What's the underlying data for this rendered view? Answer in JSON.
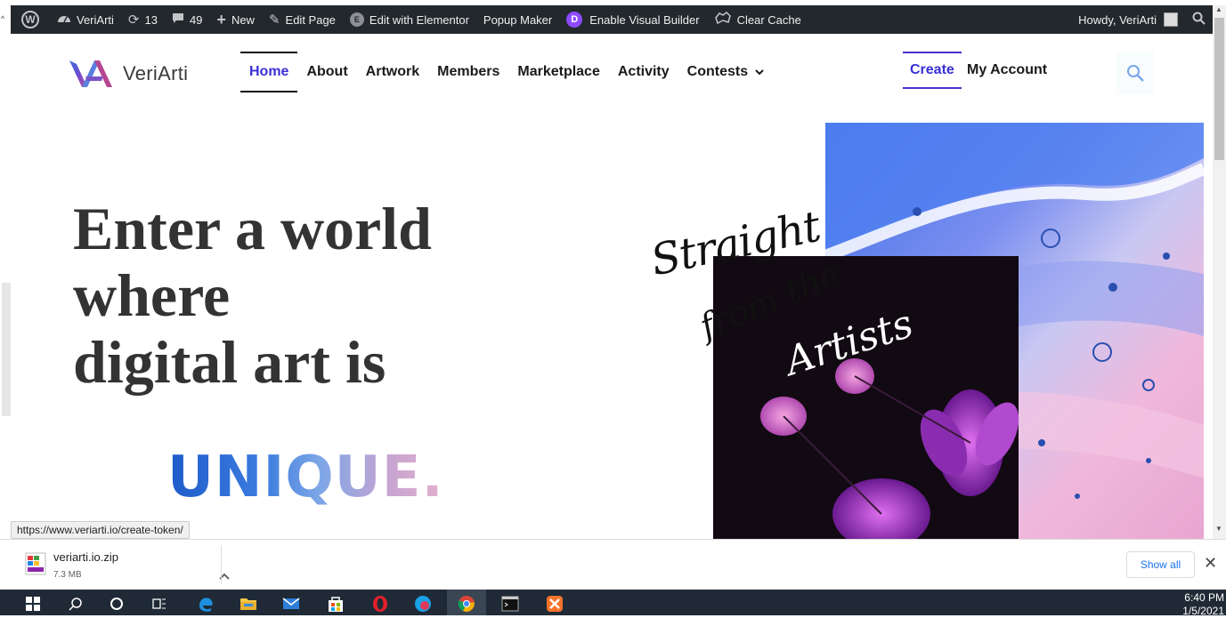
{
  "admin_bar": {
    "site_name": "VeriArti",
    "updates_count": "13",
    "comments_count": "49",
    "new_label": "New",
    "edit_page_label": "Edit Page",
    "edit_elementor_label": "Edit with Elementor",
    "popup_maker_label": "Popup Maker",
    "visual_builder_label": "Enable Visual Builder",
    "clear_cache_label": "Clear Cache",
    "howdy_label": "Howdy, VeriArti"
  },
  "header": {
    "logo_text": "VeriArti",
    "nav": [
      {
        "label": "Home",
        "active": true
      },
      {
        "label": "About"
      },
      {
        "label": "Artwork"
      },
      {
        "label": "Members"
      },
      {
        "label": "Marketplace"
      },
      {
        "label": "Activity"
      },
      {
        "label": "Contests",
        "has_dropdown": true
      }
    ],
    "create_label": "Create",
    "account_label": "My Account"
  },
  "hero": {
    "heading_line1": "Enter a world",
    "heading_line2": "where",
    "heading_line3": "digital art is",
    "highlight": "UNIQUE.",
    "art_script_line1": "Straight",
    "art_script_line2": "from the",
    "art_script_line3": "Artists"
  },
  "status_url": "https://www.veriarti.io/create-token/",
  "downloads": {
    "file_name": "veriarti.io.zip",
    "file_size": "7.3 MB",
    "show_all_label": "Show all"
  },
  "taskbar": {
    "time": "6:40 PM",
    "date": "1/5/2021"
  },
  "colors": {
    "accent": "#3a2fd6",
    "admin_bar_bg": "#23282d",
    "taskbar_bg": "#1f2a36"
  }
}
